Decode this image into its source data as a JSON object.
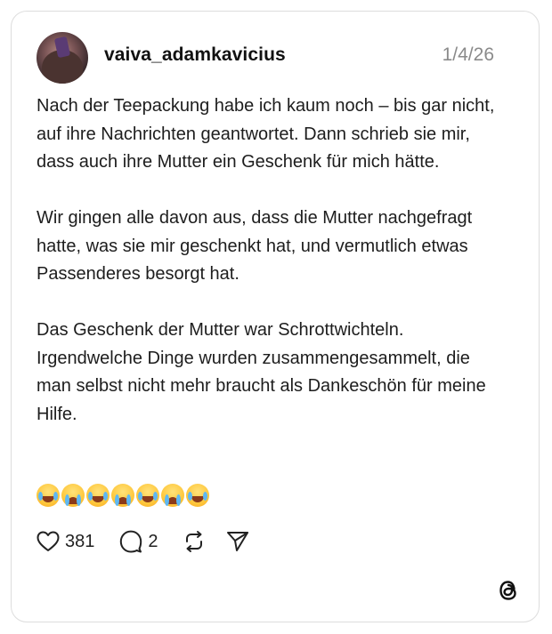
{
  "post": {
    "username": "vaiva_adamkavicius",
    "date": "1/4/26",
    "paragraphs": [
      "Nach der Teepackung habe ich kaum noch – bis gar nicht,  auf ihre Nachrichten geantwortet. Dann schrieb sie mir, dass auch ihre Mutter ein Geschenk für mich hätte.",
      "Wir gingen alle davon aus, dass die Mutter nachgefragt hatte, was sie mir geschenkt hat, und vermutlich etwas Passenderes besorgt hat.",
      "Das Geschenk der Mutter war Schrottwichteln. Irgendwelche Dinge wurden zusammengesammelt, die man selbst nicht mehr braucht als Dankeschön für meine Hilfe."
    ],
    "emojis": [
      "face-with-tears-of-joy",
      "loudly-crying-face",
      "face-with-tears-of-joy",
      "loudly-crying-face",
      "face-with-tears-of-joy",
      "loudly-crying-face",
      "face-with-tears-of-joy"
    ]
  },
  "actions": {
    "likes": "381",
    "replies": "2"
  },
  "icons": {
    "like": "heart-icon",
    "reply": "comment-icon",
    "repost": "repost-icon",
    "share": "send-icon",
    "brand": "threads-logo-icon"
  }
}
